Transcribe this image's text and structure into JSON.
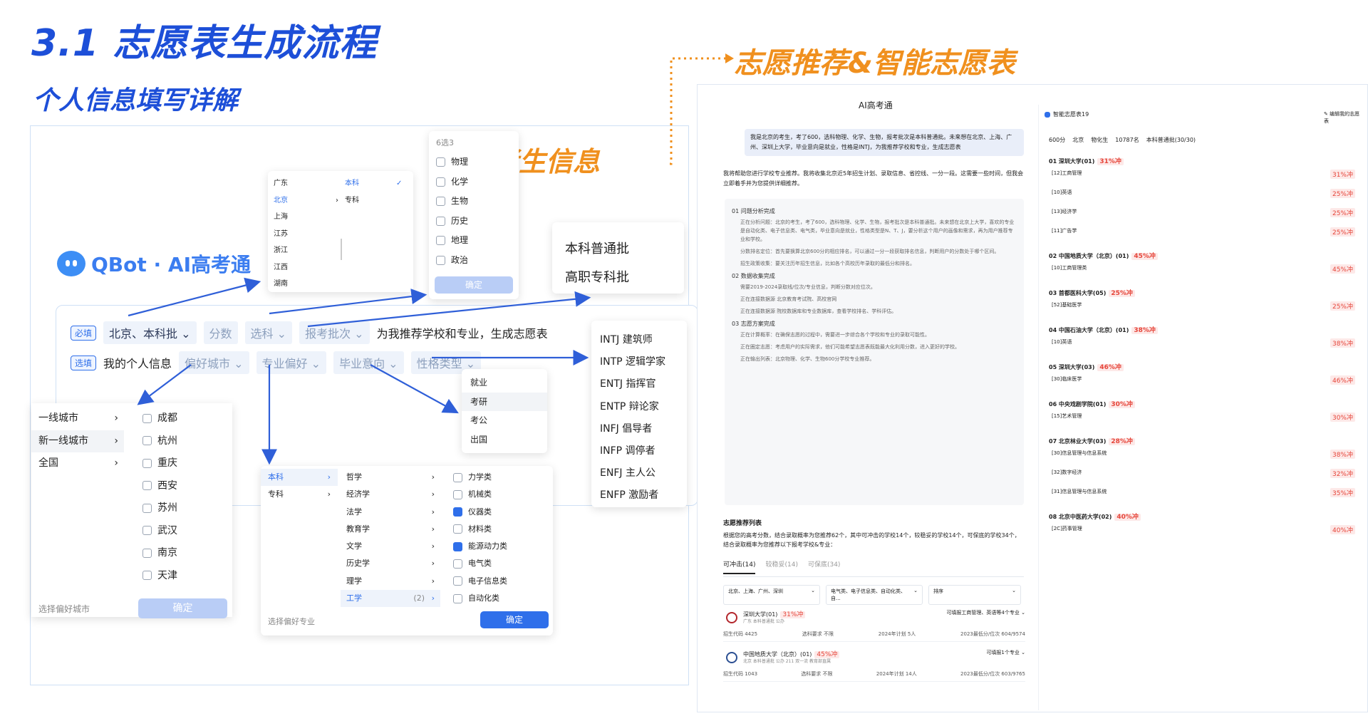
{
  "slide": {
    "title": "3.1 志愿表生成流程",
    "subtitle": "个人信息填写详解",
    "right_title": "志愿推荐&智能志愿表",
    "examinee_label": "考生信息"
  },
  "logo": {
    "text": "QBot · AI高考通"
  },
  "form": {
    "required_tag": "必填",
    "optional_tag": "选填",
    "region_batch": "北京、本科批",
    "score": "分数",
    "subject": "选科",
    "batch": "报考批次",
    "prompt_text": "为我推荐学校和专业，生成志愿表",
    "my_info": "我的个人信息",
    "city_pref": "偏好城市",
    "major_pref": "专业偏好",
    "grad_intent": "毕业意向",
    "personality": "性格类型"
  },
  "region_dropdown": {
    "provinces": [
      "广东",
      "北京",
      "上海",
      "江苏",
      "浙江",
      "江西",
      "湖南"
    ],
    "levels": [
      "本科",
      "专科"
    ]
  },
  "subject_dropdown": {
    "header": "6选3",
    "items": [
      "物理",
      "化学",
      "生物",
      "历史",
      "地理",
      "政治"
    ],
    "confirm": "确定"
  },
  "batch_dropdown": {
    "items": [
      "本科普通批",
      "高职专科批"
    ]
  },
  "personality_dropdown": {
    "items": [
      "INTJ 建筑师",
      "INTP 逻辑学家",
      "ENTJ 指挥官",
      "ENTP 辩论家",
      "INFJ 倡导者",
      "INFP 调停者",
      "ENFJ 主人公",
      "ENFP 激励者"
    ]
  },
  "intent_dropdown": {
    "items": [
      "就业",
      "考研",
      "考公",
      "出国"
    ]
  },
  "city_dropdown": {
    "tiers": [
      "一线城市",
      "新一线城市",
      "全国"
    ],
    "cities": [
      "成都",
      "杭州",
      "重庆",
      "西安",
      "苏州",
      "武汉",
      "南京",
      "天津"
    ],
    "footer": "选择偏好城市",
    "confirm": "确定"
  },
  "major_dropdown": {
    "levels": [
      "本科",
      "专科"
    ],
    "categories": [
      "哲学",
      "经济学",
      "法学",
      "教育学",
      "文学",
      "历史学",
      "理学",
      "工学"
    ],
    "count": "(2)",
    "subs": [
      "力学类",
      "机械类",
      "仪器类",
      "材料类",
      "能源动力类",
      "电气类",
      "电子信息类",
      "自动化类"
    ],
    "checked": [
      false,
      false,
      true,
      false,
      true,
      false,
      false,
      false
    ],
    "footer": "选择偏好专业",
    "confirm": "确定"
  },
  "chat": {
    "app_title": "AI高考通",
    "user_msg": "我是北京的考生，考了600，选科物理、化学、生物，报考批次是本科普通批。未来想在北京、上海、广州、深圳上大学，毕业意向是就业，性格是INTJ，为我推荐学校和专业，生成志愿表",
    "reply_intro": "我将帮助您进行学校专业推荐。我将收集北京近5年招生计划、录取信息、省控线、一分一段。这需要一些时间，但我会立即着手并为您提供详细推荐。",
    "steps": [
      {
        "title": "01 问题分析完成",
        "lines": [
          "正在分析问题：北京的考生，考了600，选科物理、化学、生物，报考批次是本科普通批。未来想在北京上大学，喜欢的专业是自动化类、电子信息类、电气类，毕业意向是就业，性格类型是N、T、J，要分析这个用户的画像和需求，再为用户推荐专业和学校。",
          "分数排名定位：首先要换算北京600分的相应排名，可以通过一分一段获取排名信息，判断用户的分数处于哪个区间。",
          "招生政策收集：要关注历年招生信息，比如各个高校历年录取的最低分和排名。"
        ]
      },
      {
        "title": "02 数据收集完成",
        "lines": [
          "需要2019-2024录取线/位次/专业信息，判断分数对应位次。",
          "正在连接数据源 北京教育考试院、高校官网",
          "正在连接数据源 院校数据库和专业数据库，查看学校排名、学科评估。"
        ]
      },
      {
        "title": "03 志愿方案完成",
        "lines": [
          "正在计算概率：在确保志愿的过程中，需要进一步综合各个学校和专业的录取可能性。",
          "正在圈定志愿：考虑用户的实际需求，他们可能希望志愿表既能最大化利用分数，进入更好的学校。",
          "正在输出列表：北京物理、化学、生物600分学校专业推荐。"
        ]
      }
    ],
    "rec_title": "志愿推荐列表",
    "rec_desc": "根据您的高考分数，结合录取概率为您推荐62个，其中可冲击的学校14个，较稳妥的学校14个，可保底的学校34个，结合录取概率为您推荐以下报考学校&专业：",
    "tabs": [
      "可冲击(14)",
      "较稳妥(14)",
      "可保底(34)"
    ],
    "filters": [
      "北京、上海、广州、深圳",
      "电气类、电子信息类、自动化类、自...",
      "排序"
    ],
    "schools": [
      {
        "name": "深圳大学(01)",
        "pct": "31%冲",
        "meta": "广东 本科普通批 公办",
        "code": "招生代码 4425",
        "req": "选科要求 不限",
        "plan": "2024年计划 5人",
        "score": "2023最低分/位次 604/9574",
        "btn": "可填报工商管理、英语等4个专业"
      },
      {
        "name": "中国地质大学（北京）(01)",
        "pct": "45%冲",
        "meta": "北京 本科普通批 公办 211 双一流 教育部直属",
        "code": "招生代码 1043",
        "req": "选科要求 不限",
        "plan": "2024年计划 14人",
        "score": "2023最低分/位次 603/9765",
        "btn": "可填报1个专业"
      }
    ]
  },
  "table": {
    "title": "智能志愿表19",
    "edit": "编辑我的志愿表",
    "summary": [
      "600分",
      "北京",
      "物化生",
      "10787名",
      "本科普通批(30/30)"
    ],
    "groups": [
      {
        "school": "01 深圳大学(01)",
        "pct": "31%冲",
        "majors": [
          {
            "name": "[12]工商管理",
            "pct": "31%冲"
          },
          {
            "name": "[10]英语",
            "pct": "25%冲"
          },
          {
            "name": "[13]经济学",
            "pct": "25%冲"
          },
          {
            "name": "[11]广告学",
            "pct": "25%冲"
          }
        ]
      },
      {
        "school": "02 中国地质大学（北京）(01)",
        "pct": "45%冲",
        "majors": [
          {
            "name": "[10]工商管理类",
            "pct": "45%冲"
          }
        ]
      },
      {
        "school": "03 首都医科大学(05)",
        "pct": "25%冲",
        "majors": [
          {
            "name": "[52]基础医学",
            "pct": "25%冲"
          }
        ]
      },
      {
        "school": "04 中国石油大学（北京）(01)",
        "pct": "38%冲",
        "majors": [
          {
            "name": "[10]英语",
            "pct": "38%冲"
          }
        ]
      },
      {
        "school": "05 深圳大学(03)",
        "pct": "46%冲",
        "majors": [
          {
            "name": "[30]临床医学",
            "pct": "46%冲"
          }
        ]
      },
      {
        "school": "06 中央戏剧学院(01)",
        "pct": "30%冲",
        "majors": [
          {
            "name": "[15]艺术管理",
            "pct": "30%冲"
          }
        ]
      },
      {
        "school": "07 北京林业大学(03)",
        "pct": "28%冲",
        "majors": [
          {
            "name": "[30]信息管理与信息系统",
            "pct": "38%冲"
          },
          {
            "name": "[32]数字经济",
            "pct": "32%冲"
          },
          {
            "name": "[31]信息管理与信息系统",
            "pct": "35%冲"
          }
        ]
      },
      {
        "school": "08 北京中医药大学(02)",
        "pct": "40%冲",
        "majors": [
          {
            "name": "[2C]药事管理",
            "pct": "40%冲"
          }
        ]
      }
    ]
  },
  "colors": {
    "blue": "#1d4fd8",
    "orange": "#f0901e",
    "accent": "#2f6fea"
  }
}
